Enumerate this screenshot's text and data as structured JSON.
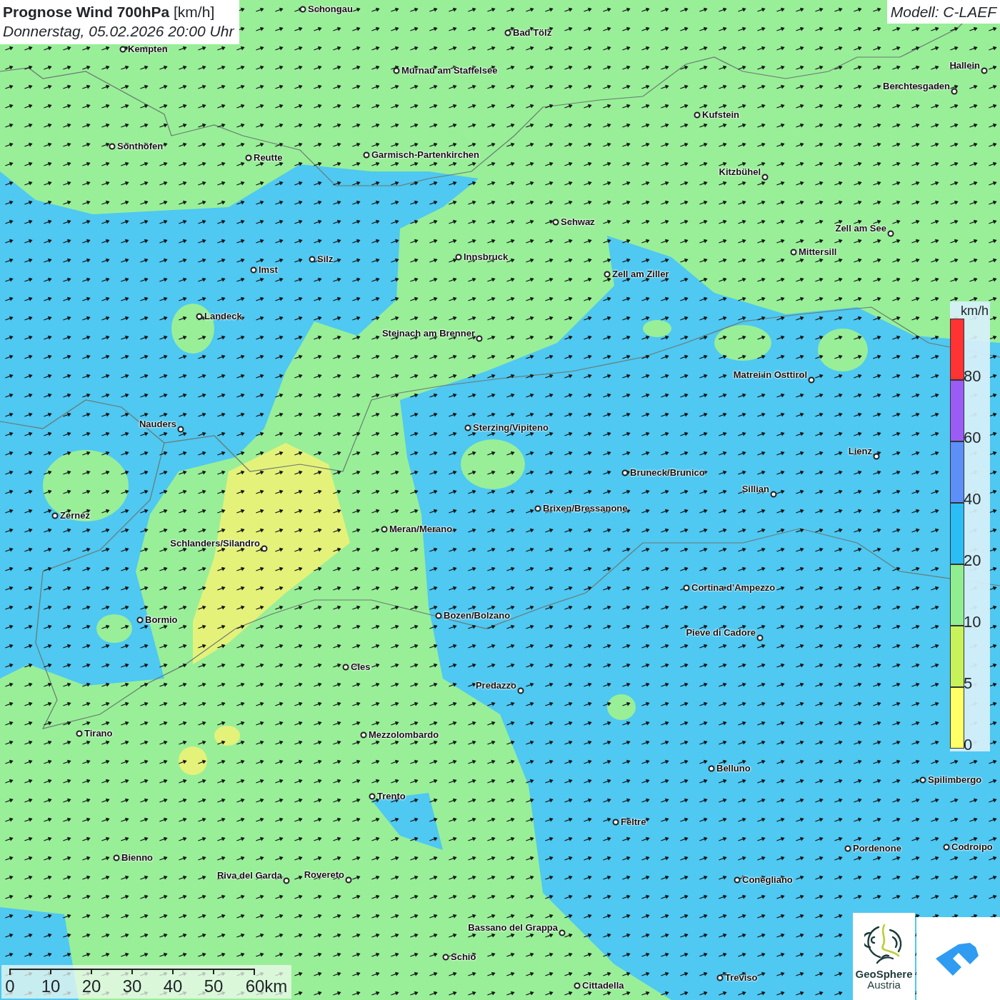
{
  "title": {
    "heading": "**Prognose Wind 700hPa** [km/h]",
    "subtitle": "Donnerstag, 05.02.2026 20:00 Uhr"
  },
  "model": "Modell: C-LAEF",
  "cities": [
    {
      "name": "Schongau"
    },
    {
      "name": "Bad Tölz"
    },
    {
      "name": "Kempten"
    },
    {
      "name": "Murnau am Staffelsee"
    },
    {
      "name": "Hallein"
    },
    {
      "name": "Berchtesgaden"
    },
    {
      "name": "Kufstein"
    },
    {
      "name": "Sonthofen"
    },
    {
      "name": "Garmisch-Partenkirchen"
    },
    {
      "name": "Reutte"
    },
    {
      "name": "Kitzbühel"
    },
    {
      "name": "Schwaz"
    },
    {
      "name": "Zell am See"
    },
    {
      "name": "Mittersill"
    },
    {
      "name": "Innsbruck"
    },
    {
      "name": "Silz"
    },
    {
      "name": "Imst"
    },
    {
      "name": "Zell am Ziller"
    },
    {
      "name": "Landeck"
    },
    {
      "name": "Steinach am Brenner"
    },
    {
      "name": "Matrei in Osttirol"
    },
    {
      "name": "Nauders"
    },
    {
      "name": "Sterzing/Vipiteno"
    },
    {
      "name": "Lienz"
    },
    {
      "name": "Bruneck/Brunico"
    },
    {
      "name": "Sillian"
    },
    {
      "name": "Brixen/Bressanone"
    },
    {
      "name": "Zernez"
    },
    {
      "name": "Meran/Merano"
    },
    {
      "name": "Schlanders/Silandro"
    },
    {
      "name": "Cortina d'Ampezzo"
    },
    {
      "name": "Bozen/Bolzano"
    },
    {
      "name": "Bormio"
    },
    {
      "name": "Pieve di Cadore"
    },
    {
      "name": "Cles"
    },
    {
      "name": "Predazzo"
    },
    {
      "name": "Tirano"
    },
    {
      "name": "Mezzolombardo"
    },
    {
      "name": "Belluno"
    },
    {
      "name": "Spilimbergo"
    },
    {
      "name": "Trento"
    },
    {
      "name": "Feltre"
    },
    {
      "name": "Pordenone"
    },
    {
      "name": "Codroipo"
    },
    {
      "name": "Bienno"
    },
    {
      "name": "Riva del Garda"
    },
    {
      "name": "Rovereto"
    },
    {
      "name": "Conegliano"
    },
    {
      "name": "Bassano del Grappa"
    },
    {
      "name": "Schio"
    },
    {
      "name": "Treviso"
    },
    {
      "name": "Cittadella"
    }
  ],
  "legend": {
    "unit": "km/h",
    "bands": [
      {
        "color": "#ff3333",
        "label": "80"
      },
      {
        "color": "#9b5cf6",
        "label": "60"
      },
      {
        "color": "#5c8ff8",
        "label": "40"
      },
      {
        "color": "#2bbdf5",
        "label": "20"
      },
      {
        "color": "#90ee90",
        "label": "10"
      },
      {
        "color": "#c8f25a",
        "label": "5"
      },
      {
        "color": "#ffff66",
        "label": "0"
      }
    ]
  },
  "scale_bar": [
    "0",
    "10",
    "20",
    "30",
    "40",
    "50",
    "60km"
  ],
  "logos": {
    "brand": "GeoSphere",
    "sub": "Austria"
  }
}
